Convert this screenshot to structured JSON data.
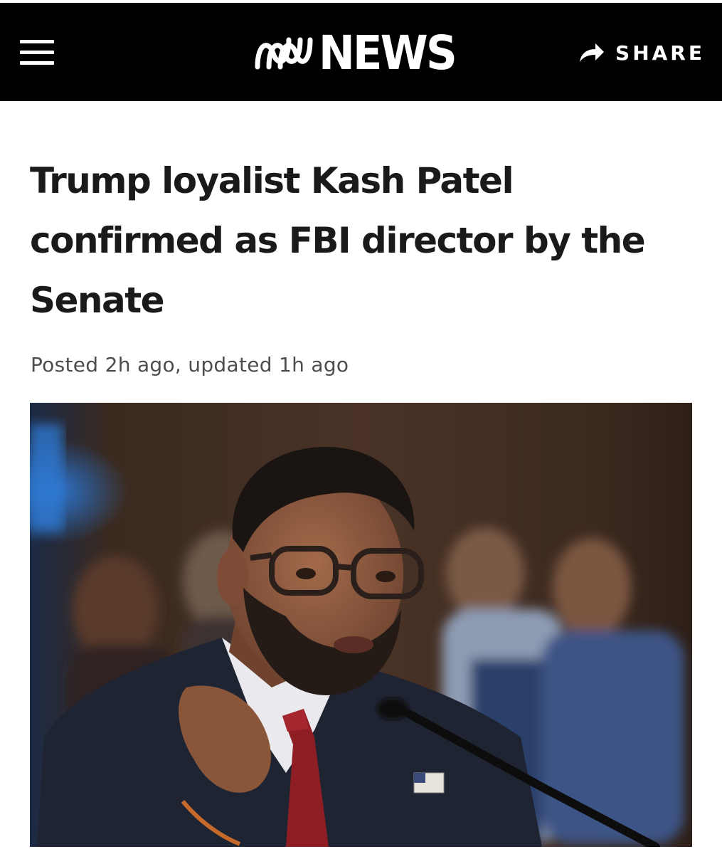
{
  "header": {
    "menu_icon": "hamburger-menu-icon",
    "logo_text": "NEWS",
    "logo_icon": "abc-lissajous-logo-icon",
    "share_label": "SHARE",
    "share_icon": "share-arrow-icon",
    "background_color": "#000000",
    "text_color": "#ffffff"
  },
  "article": {
    "headline": "Trump loyalist Kash Patel confirmed as FBI director by the Senate",
    "timestamp": "Posted 2h ago, updated 1h ago",
    "headline_color": "#1a1a1a",
    "meta_color": "#4d4d4d"
  },
  "hero_image": {
    "subject": "man-with-glasses-speaking-at-hearing-photo"
  }
}
